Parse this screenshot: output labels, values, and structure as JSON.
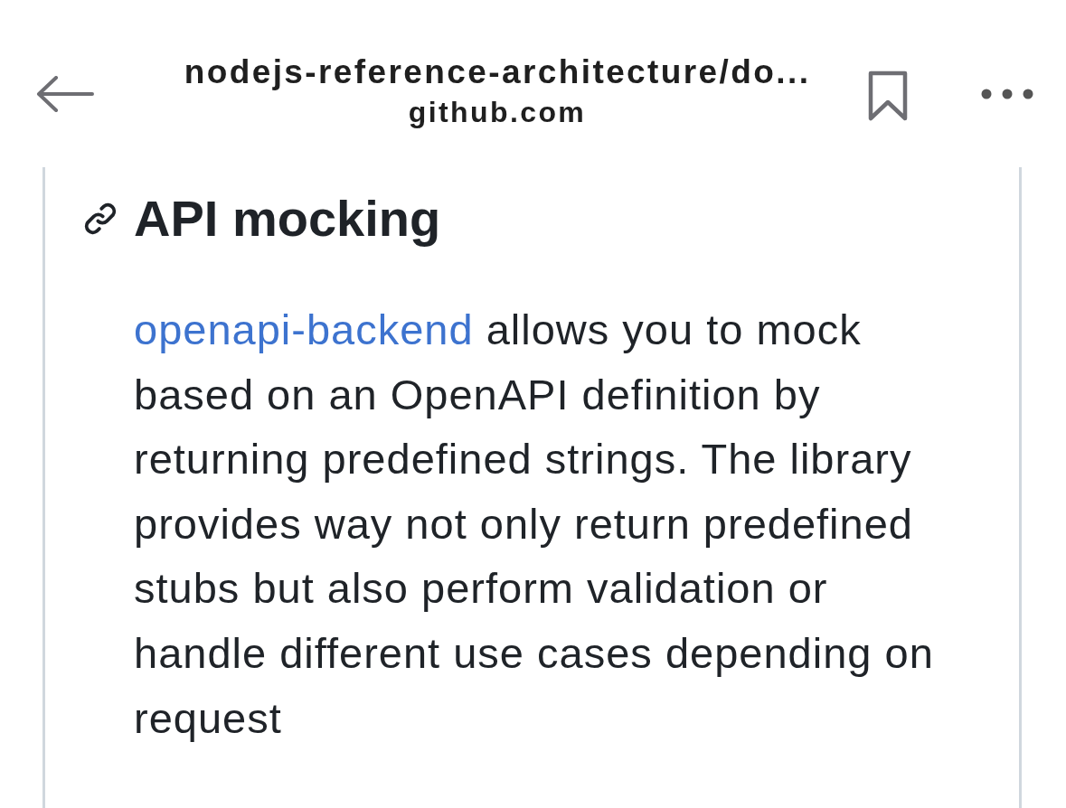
{
  "toolbar": {
    "title": "nodejs-reference-architecture/do...",
    "subtitle": "github.com"
  },
  "section": {
    "heading": "API mocking",
    "paragraph": {
      "link": "openapi-backend",
      "text": "allows you to mock based on an OpenAPI definition by returning predefined strings. The library provides way not only return predefined stubs but also perform validation or handle different use cases depending on request"
    }
  }
}
